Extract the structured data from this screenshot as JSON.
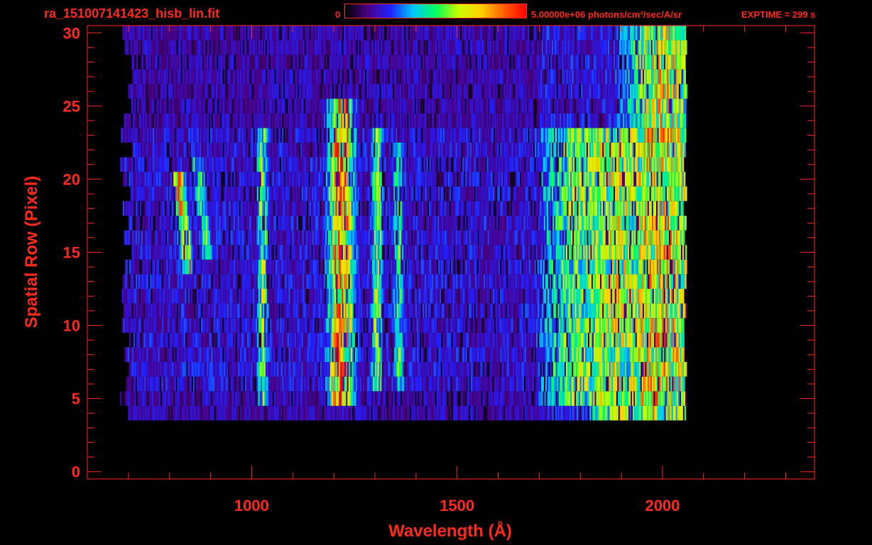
{
  "header": {
    "file_title": "ra_151007141423_hisb_lin.fit",
    "colorbar_min_label": "0",
    "colorbar_max_value": "5.00000e+06",
    "colorbar_units": "photons/cm²/sec/A/sr",
    "exptime_label": "EXPTIME = 299 s"
  },
  "colors": {
    "axis": "#ff2a1a",
    "background": "#000000",
    "colormap": [
      "#000000",
      "#4b0082",
      "#2020ff",
      "#00c8ff",
      "#00ff60",
      "#c8ff00",
      "#ffd000",
      "#ff6000",
      "#ff0000"
    ]
  },
  "chart_data": {
    "type": "heatmap",
    "title": "ra_151007141423_hisb_lin.fit",
    "xlabel": "Wavelength (Å)",
    "ylabel": "Spatial Row (Pixel)",
    "xlim": [
      600,
      2370
    ],
    "ylim": [
      -0.5,
      30.5
    ],
    "x_ticks": [
      1000,
      1500,
      2000
    ],
    "y_ticks": [
      0,
      5,
      10,
      15,
      20,
      25,
      30
    ],
    "colorbar": {
      "min": 0,
      "max": 5000000,
      "units": "photons/cm²/sec/A/sr"
    },
    "exptime_s": 299,
    "data_extent": {
      "x": [
        680,
        2060
      ],
      "rows": [
        4,
        30
      ]
    },
    "emission_features": [
      {
        "wavelength": 820,
        "rows": [
          14,
          20
        ],
        "level": 0.62
      },
      {
        "wavelength": 870,
        "rows": [
          15,
          21
        ],
        "level": 0.38
      },
      {
        "wavelength": 1025,
        "rows": [
          5,
          23
        ],
        "level": 0.42
      },
      {
        "wavelength": 1216,
        "rows": [
          5,
          25
        ],
        "level": 0.72
      },
      {
        "wavelength": 1304,
        "rows": [
          6,
          23
        ],
        "level": 0.45
      },
      {
        "wavelength": 1356,
        "rows": [
          6,
          22
        ],
        "level": 0.34
      },
      {
        "wavelength": 1800,
        "rows": [
          5,
          23
        ],
        "level": 0.4
      },
      {
        "wavelength": 1900,
        "rows": [
          4,
          23
        ],
        "level": 0.44
      },
      {
        "wavelength": 2000,
        "rows": [
          2,
          30
        ],
        "level": 0.5
      }
    ],
    "grid": false
  }
}
